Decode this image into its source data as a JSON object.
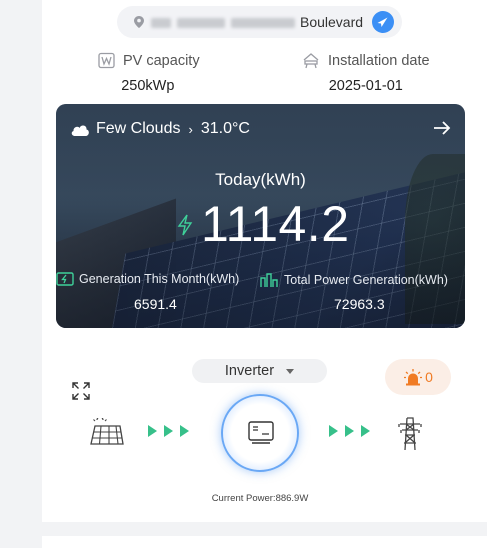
{
  "address": {
    "street": "Boulevard"
  },
  "stats": {
    "pv_capacity": {
      "label": "PV capacity",
      "value": "250kWp"
    },
    "installation_date": {
      "label": "Installation date",
      "value": "2025-01-01"
    }
  },
  "weather": {
    "condition": "Few Clouds",
    "separator": "›",
    "temperature": "31.0°C"
  },
  "today": {
    "label": "Today(kWh)",
    "value": "1114.2"
  },
  "metrics": {
    "month": {
      "label": "Generation This Month(kWh)",
      "value": "6591.4"
    },
    "total": {
      "label": "Total Power Generation(kWh)",
      "value": "72963.3"
    }
  },
  "flow": {
    "device_select": "Inverter",
    "alarm_count": "0",
    "current_power": "Current Power:886.9W"
  },
  "colors": {
    "accent": "#3b8ff5",
    "flow_green": "#37c08a",
    "alarm_orange": "#f07b24"
  }
}
